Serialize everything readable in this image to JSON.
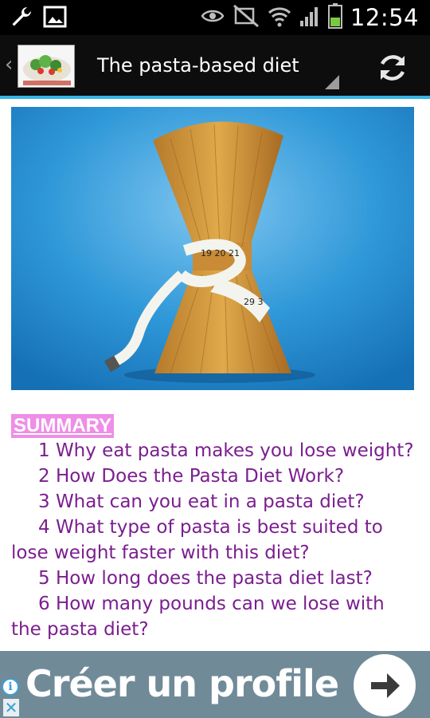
{
  "status_bar": {
    "time": "12:54",
    "left_icons": [
      "wrench-icon",
      "picture-icon"
    ],
    "right_icons": [
      "eye-icon",
      "mute-icon",
      "wifi-icon",
      "signal-icon",
      "battery-icon"
    ]
  },
  "action_bar": {
    "title": "The pasta-based diet",
    "app_logo": "salad-logo",
    "refresh_icon": "refresh-icon",
    "accent_color": "#33b5e5"
  },
  "article": {
    "hero_image": "pasta-with-measuring-tape",
    "summary_title": "SUMMARY",
    "toc": [
      "1 Why eat pasta makes you lose weight?",
      "2 How Does the Pasta Diet Work?",
      "3 What can you eat in a pasta diet?",
      "4 What type of pasta is best suited to lose weight faster with this diet?",
      "5 How long does the pasta diet last?",
      "6 How many pounds can we lose with the pasta diet?"
    ],
    "link_color": "#7b1e8f"
  },
  "ad": {
    "text": "Créer un profile",
    "info_label": "i",
    "close_label": "✕",
    "background": "#708a98"
  }
}
